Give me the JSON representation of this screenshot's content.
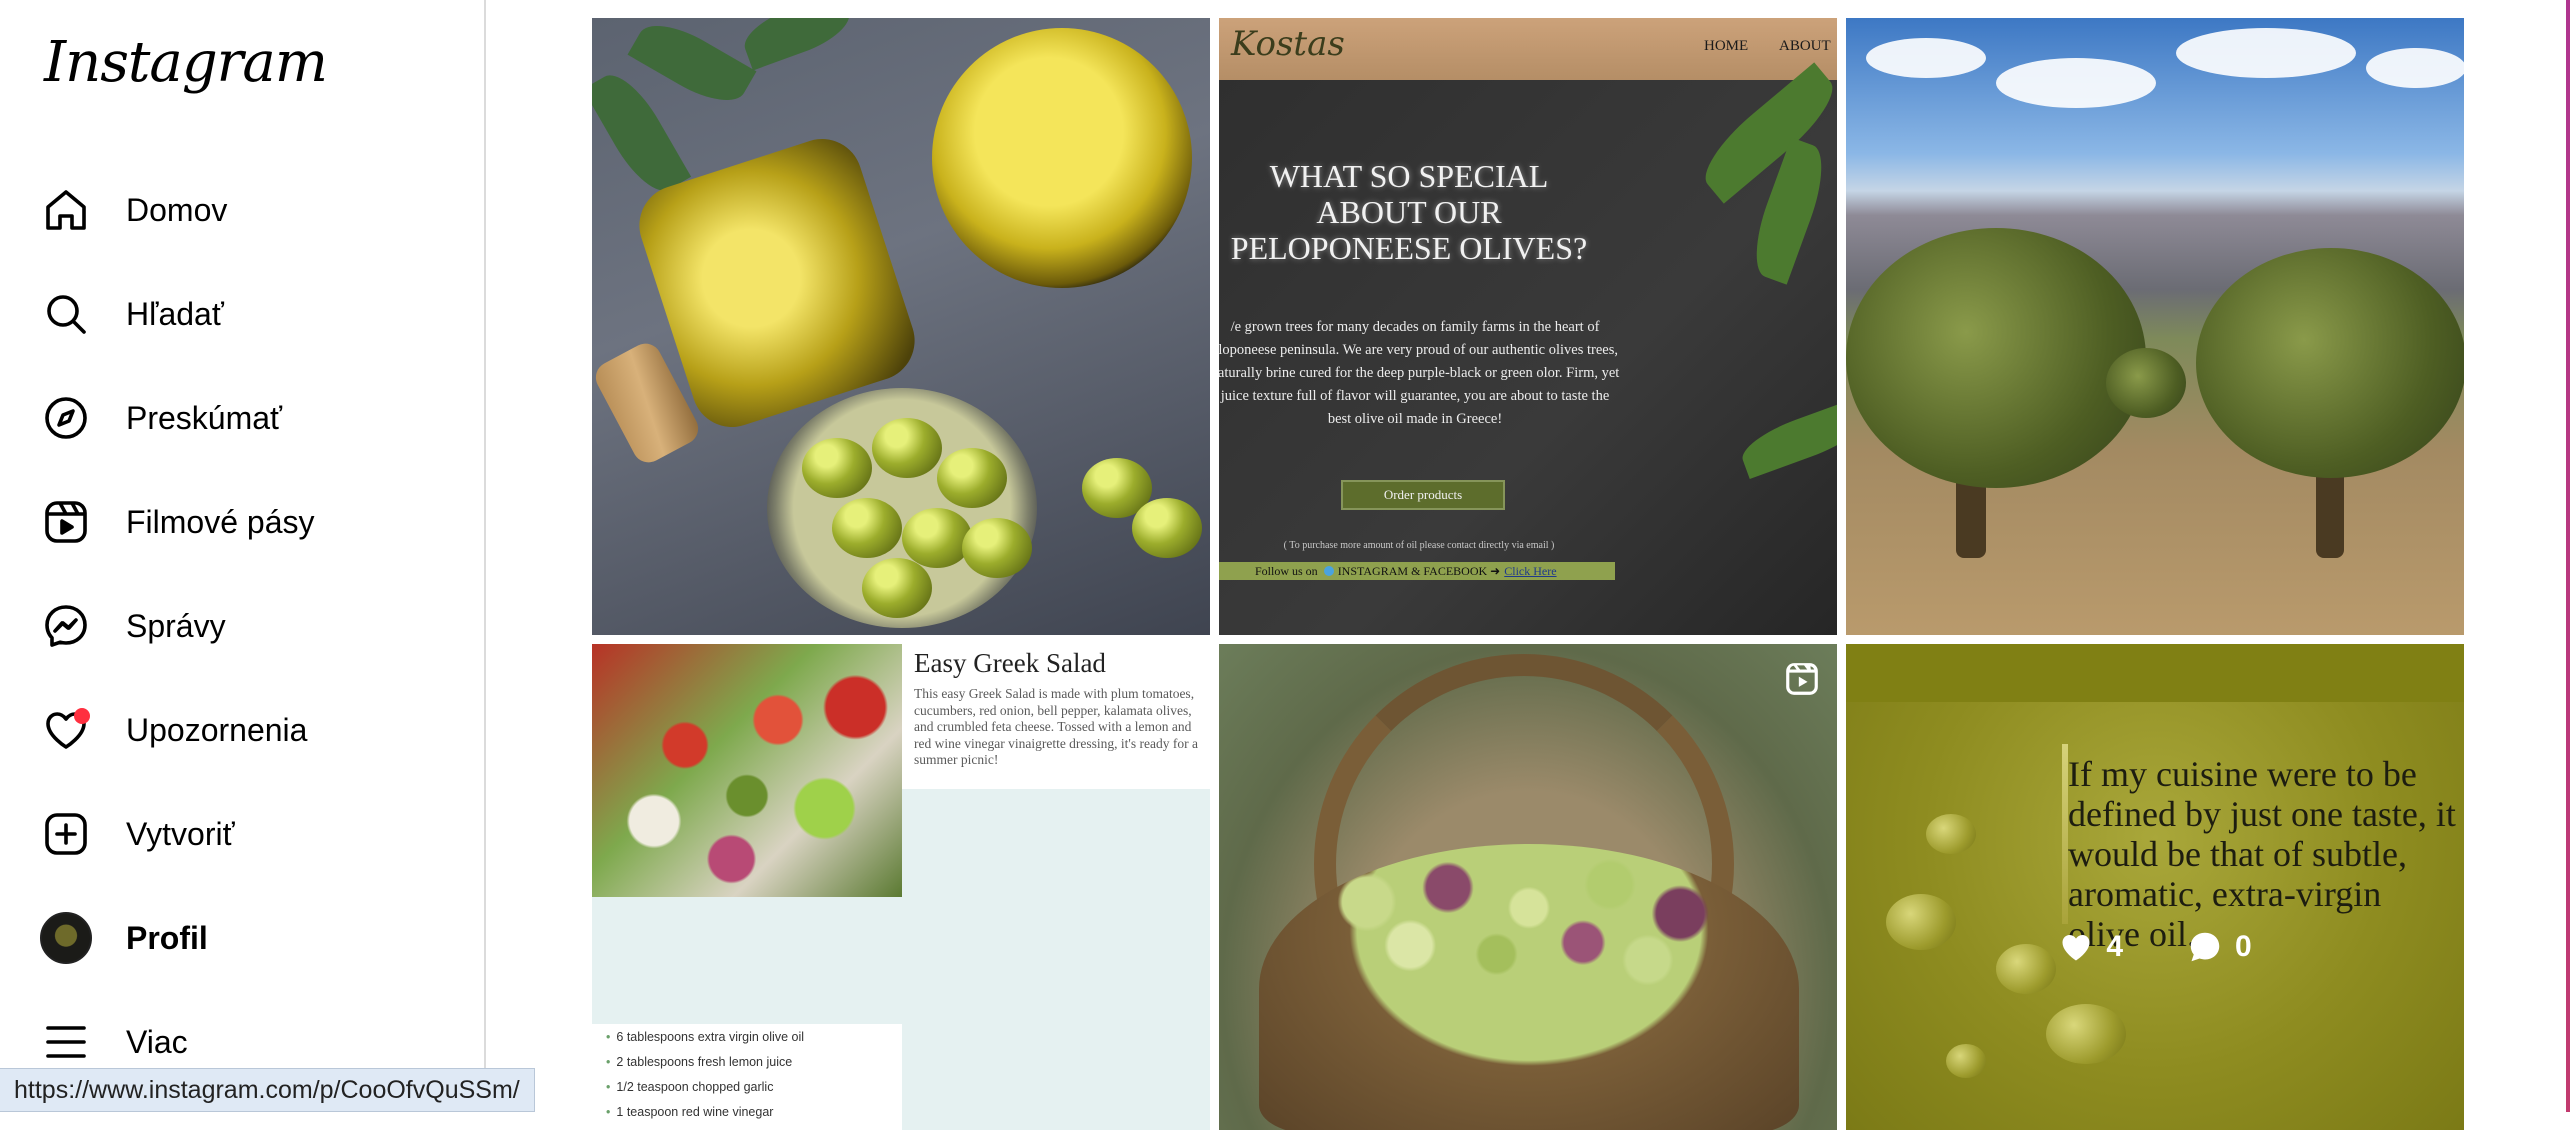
{
  "app": {
    "logo": "Instagram"
  },
  "sidebar": {
    "items": [
      {
        "label": "Domov",
        "icon": "home-icon"
      },
      {
        "label": "Hľadať",
        "icon": "search-icon"
      },
      {
        "label": "Preskúmať",
        "icon": "compass-icon"
      },
      {
        "label": "Filmové pásy",
        "icon": "reels-icon"
      },
      {
        "label": "Správy",
        "icon": "messenger-icon"
      },
      {
        "label": "Upozornenia",
        "icon": "heart-icon"
      },
      {
        "label": "Vytvoriť",
        "icon": "plus-square-icon"
      },
      {
        "label": "Profil",
        "icon": "avatar"
      },
      {
        "label": "Viac",
        "icon": "menu-icon"
      }
    ],
    "notification_dot_color": "#ff3040"
  },
  "status_bar": {
    "url": "https://www.instagram.com/p/CooOfvQuSSm/"
  },
  "posts": {
    "website": {
      "brand": "Kostas",
      "menu": [
        "HOME",
        "ABOUT"
      ],
      "headline": "WHAT SO SPECIAL ABOUT OUR PELOPONEESE OLIVES?",
      "body": "/e grown trees for many decades on family farms in the heart of eloponeese peninsula. We are very proud of our authentic olives trees, naturally brine cured for the deep purple-black or green olor. Firm, yet juice texture full of flavor will guarantee, you are about to taste the best olive oil made in Greece!",
      "order_button": "Order products",
      "note": "( To purchase more amount of oil please contact directly via email )",
      "follow_text": "Follow us on",
      "follow_networks": "INSTAGRAM & FACEBOOK ➜",
      "follow_link": "Click Here"
    },
    "salad": {
      "title": "Easy Greek Salad",
      "description": "This easy Greek Salad is made with plum tomatoes, cucumbers, red onion, bell pepper, kalamata olives, and crumbled feta cheese. Tossed with a lemon and red wine vinegar vinaigrette dressing, it's ready for a summer picnic!",
      "ingredients": [
        "6 tablespoons extra virgin olive oil",
        "2 tablespoons fresh lemon juice",
        "1/2 teaspoon chopped garlic",
        "1 teaspoon red wine vinegar"
      ]
    },
    "quote": {
      "text": "If my cuisine were to be defined by just one taste, it would be that of subtle, aromatic, extra-virgin olive oil.",
      "likes": "4",
      "comments": "0"
    }
  }
}
